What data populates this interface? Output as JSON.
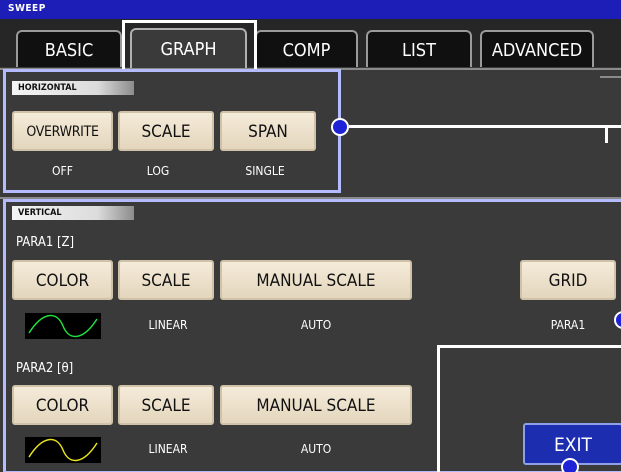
{
  "title": "SWEEP",
  "tabs": [
    {
      "label": "BASIC",
      "active": false
    },
    {
      "label": "GRAPH",
      "active": true
    },
    {
      "label": "COMP",
      "active": false
    },
    {
      "label": "LIST",
      "active": false
    },
    {
      "label": "ADVANCED",
      "active": false
    }
  ],
  "horizontal": {
    "label": "HORIZONTAL",
    "buttons": [
      {
        "label": "OVERWRITE",
        "value": "OFF"
      },
      {
        "label": "SCALE",
        "value": "LOG"
      },
      {
        "label": "SPAN",
        "value": "SINGLE"
      }
    ]
  },
  "vertical": {
    "label": "VERTICAL",
    "para1": {
      "label": "PARA1 [Z]",
      "color_button": "COLOR",
      "wave_color": "#20e040",
      "scale_button": "SCALE",
      "scale_value": "LINEAR",
      "manual_scale_button": "MANUAL SCALE",
      "manual_scale_value": "AUTO"
    },
    "para2": {
      "label": "PARA2 [θ]",
      "color_button": "COLOR",
      "wave_color": "#e8e020",
      "scale_button": "SCALE",
      "scale_value": "LINEAR",
      "manual_scale_button": "MANUAL SCALE",
      "manual_scale_value": "AUTO"
    },
    "grid_button": "GRID",
    "grid_value": "PARA1"
  },
  "exit_button": "EXIT",
  "colors": {
    "title_bar": "#1d1db8",
    "screen_background": "#3a3a3a",
    "button_face": "#f0e6d2",
    "exit_button": "#1d2db0",
    "callout_frame": "#b4bcff",
    "callout_dot": "#1e24d6"
  }
}
